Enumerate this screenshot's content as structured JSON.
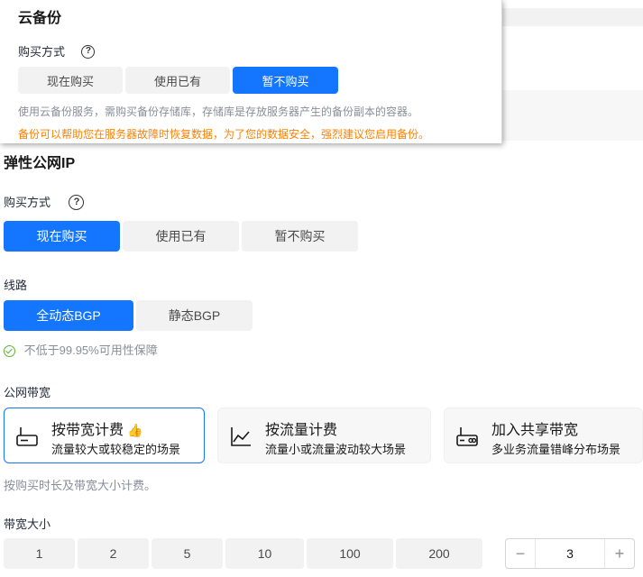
{
  "cloud_backup": {
    "title": "云备份",
    "purchase_label": "购买方式",
    "options": [
      "现在购买",
      "使用已有",
      "暂不购买"
    ],
    "selected": "暂不购买",
    "note_gray": "使用云备份服务，需购买备份存储库，存储库是存放服务器产生的备份副本的容器。",
    "note_orange": "备份可以帮助您在服务器故障时恢复数据，为了您的数据安全，强烈建议您启用备份。"
  },
  "eip": {
    "title": "弹性公网IP",
    "purchase_label": "购买方式",
    "purchase_options": [
      "现在购买",
      "使用已有",
      "暂不购买"
    ],
    "purchase_selected": "现在购买",
    "line_label": "线路",
    "line_options": [
      "全动态BGP",
      "静态BGP"
    ],
    "line_selected": "全动态BGP",
    "availability": "不低于99.95%可用性保障",
    "bandwidth_label": "公网带宽",
    "billing_cards": [
      {
        "title": "按带宽计费",
        "subtitle": "流量较大或较稳定的场景",
        "icon": "router-icon"
      },
      {
        "title": "按流量计费",
        "subtitle": "流量小或流量波动较大场景",
        "icon": "line-chart-icon"
      },
      {
        "title": "加入共享带宽",
        "subtitle": "多业务流量错峰分布场景",
        "icon": "shared-router-icon"
      }
    ],
    "billing_selected": "按带宽计费",
    "billing_note": "按购买时长及带宽大小计费。",
    "size_label": "带宽大小",
    "size_options": [
      "1",
      "2",
      "5",
      "10",
      "100",
      "200"
    ],
    "stepper": {
      "minus": "−",
      "value": "3",
      "plus": "+"
    }
  },
  "colors": {
    "accent": "#1476ff",
    "orange": "#ff8000",
    "success": "#5fb333"
  }
}
